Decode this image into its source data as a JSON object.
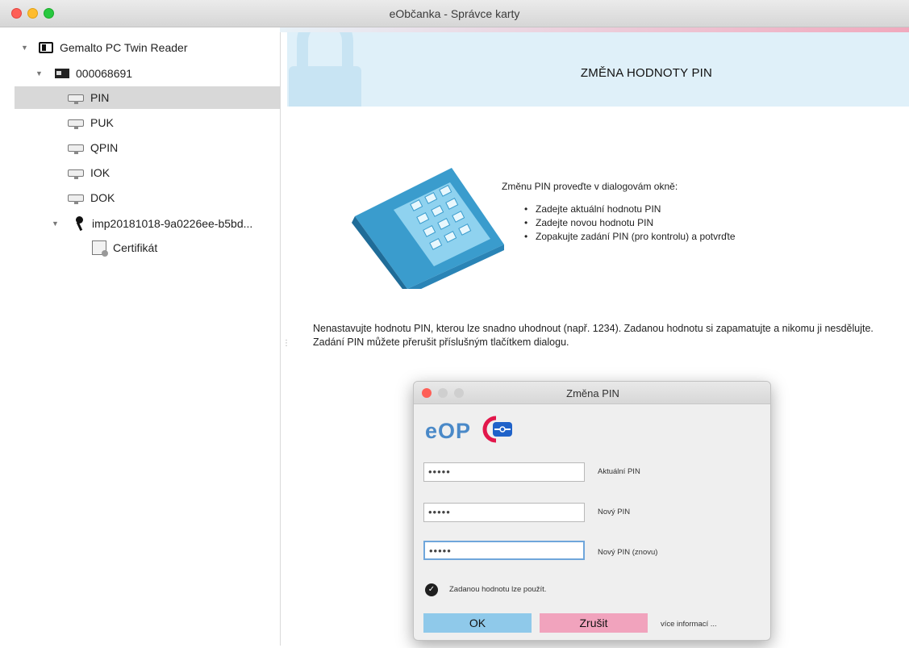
{
  "window": {
    "title": "eObčanka - Správce karty"
  },
  "sidebar": {
    "reader": "Gemalto PC Twin Reader",
    "card": "000068691",
    "items": [
      {
        "label": "PIN",
        "icon": "pin-icon",
        "selected": true
      },
      {
        "label": "PUK",
        "icon": "pin-icon"
      },
      {
        "label": "QPIN",
        "icon": "pin-icon"
      },
      {
        "label": "IOK",
        "icon": "pin-icon"
      },
      {
        "label": "DOK",
        "icon": "pin-icon"
      }
    ],
    "key": "imp20181018-9a0226ee-b5bd...",
    "cert": "Certifikát"
  },
  "main": {
    "title": "ZMĚNA HODNOTY PIN",
    "instructions_head": "Změnu PIN proveďte v dialogovám okně:",
    "instructions": [
      "Zadejte aktuální hodnotu PIN",
      "Zadejte novou hodnotu PIN",
      "Zopakujte zadání PIN (pro kontrolu) a potvrďte"
    ],
    "warning_line1": "Nenastavujte hodnotu PIN, kterou lze snadno uhodnout (např. 1234). Zadanou hodnotu si zapamatujte a nikomu ji nesdělujte.",
    "warning_line2": "Zadání PIN můžete přerušit příslušným tlačítkem dialogu."
  },
  "dialog": {
    "title": "Změna PIN",
    "logo": "eOP",
    "fields": [
      {
        "value": "•••••",
        "label": "Aktuální PIN"
      },
      {
        "value": "•••••",
        "label": "Nový PIN"
      },
      {
        "value": "•••••",
        "label": "Nový PIN (znovu)"
      }
    ],
    "check_label": "Zadanou hodnotu lze použít.",
    "ok": "OK",
    "cancel": "Zrušit",
    "more": "více informací ..."
  },
  "colors": {
    "accent_blue": "#8fc9ea",
    "accent_pink": "#f1a3bd",
    "banner": "#dff0f9"
  }
}
